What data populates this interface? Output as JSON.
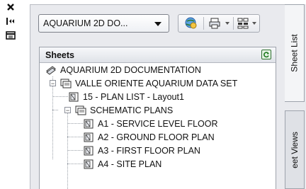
{
  "toolbar": {
    "sheet_set": "AQUARIUM 2D DO..."
  },
  "sheets": {
    "header": "Sheets",
    "tree": [
      {
        "label": "AQUARIUM 2D DOCUMENTATION",
        "type": "sheet-set"
      },
      {
        "label": "VALLE ORIENTE AQUARIUM DATA SET",
        "type": "subset",
        "expanded": true
      },
      {
        "label": "15 - PLAN LIST - Layout1",
        "type": "sheet"
      },
      {
        "label": "SCHEMATIC PLANS",
        "type": "subset",
        "expanded": true
      },
      {
        "label": "A1 - SERVICE LEVEL FLOOR",
        "type": "sheet"
      },
      {
        "label": "A2 - GROUND FLOOR PLAN",
        "type": "sheet"
      },
      {
        "label": "A3 - FIRST FLOOR PLAN",
        "type": "sheet"
      },
      {
        "label": "A4 - SITE PLAN",
        "type": "sheet"
      }
    ]
  },
  "tabs": {
    "sheet_list": "Sheet List",
    "sheet_views": "eet Views"
  }
}
